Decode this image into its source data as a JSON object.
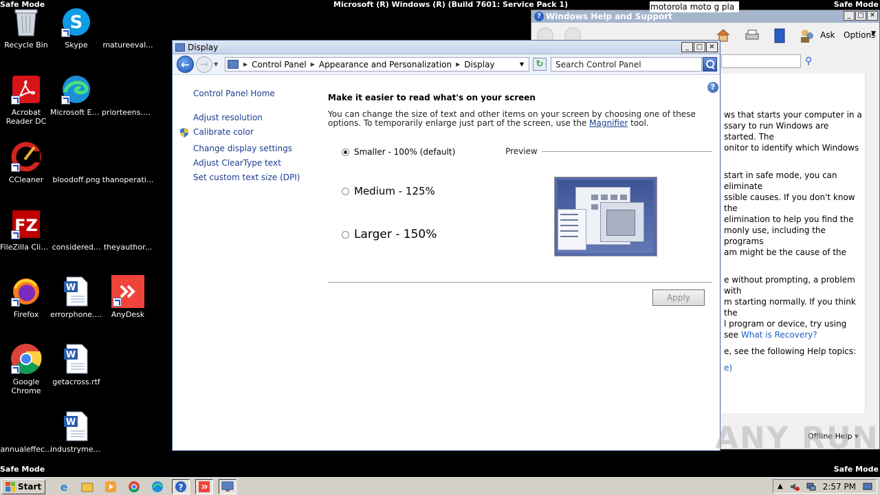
{
  "screen": {
    "top_left": "Safe Mode",
    "top_right": "Safe Mode",
    "bottom_left": "Safe Mode",
    "bottom_right": "Safe Mode",
    "build_title": "Microsoft (R) Windows (R) (Build 7601: Service Pack 1)",
    "floating_text": "motorola moto g pla"
  },
  "desktop_icons": [
    {
      "label": "Recycle Bin",
      "icon": "recycle-bin-icon"
    },
    {
      "label": "Skype",
      "icon": "skype-icon"
    },
    {
      "label": "matureeval...",
      "icon": "blank-file-icon"
    },
    {
      "label": "Acrobat Reader DC",
      "icon": "acrobat-icon"
    },
    {
      "label": "Microsoft Edge",
      "icon": "edge-icon"
    },
    {
      "label": "priorteens.png",
      "icon": "blank-file-icon"
    },
    {
      "label": "CCleaner",
      "icon": "ccleaner-icon"
    },
    {
      "label": "bloodoff.png",
      "icon": "blank-file-icon"
    },
    {
      "label": "thanoperati...",
      "icon": "blank-file-icon"
    },
    {
      "label": "FileZilla Client",
      "icon": "filezilla-icon"
    },
    {
      "label": "considered...",
      "icon": "blank-file-icon"
    },
    {
      "label": "theyauthor...",
      "icon": "blank-file-icon"
    },
    {
      "label": "Firefox",
      "icon": "firefox-icon"
    },
    {
      "label": "errorphone.rtf",
      "icon": "word-doc-icon"
    },
    {
      "label": "AnyDesk",
      "icon": "anydesk-icon"
    },
    {
      "label": "Google Chrome",
      "icon": "chrome-icon"
    },
    {
      "label": "getacross.rtf",
      "icon": "word-doc-icon"
    },
    {
      "label": "annualeffec...",
      "icon": "blank-file-icon"
    },
    {
      "label": "industrymee...",
      "icon": "word-doc-icon"
    }
  ],
  "help_window": {
    "title": "Windows Help and Support",
    "ask_label": "Ask",
    "options_label": "Options",
    "content": [
      "ws that starts your computer in a",
      "ssary to run Windows are started. The",
      "onitor to identify which Windows",
      "start in safe mode, you can eliminate",
      "ssible causes. If you don't know the",
      "elimination to help you find the",
      "monly use, including the programs",
      "am might be the cause of the",
      "e without prompting, a problem with",
      "m starting normally. If you think the",
      "l program or device, try using",
      "see",
      "e, see the following Help topics:",
      "e)"
    ],
    "recovery_link": "What is Recovery?",
    "offline_help": "Offline Help"
  },
  "display_window": {
    "title": "Display",
    "breadcrumbs": [
      "Control Panel",
      "Appearance and Personalization",
      "Display"
    ],
    "search_placeholder": "Search Control Panel",
    "left_nav": {
      "home": "Control Panel Home",
      "items": [
        "Adjust resolution",
        "Calibrate color",
        "Change display settings",
        "Adjust ClearType text",
        "Set custom text size (DPI)"
      ]
    },
    "heading": "Make it easier to read what's on your screen",
    "desc_part1": "You can change the size of text and other items on your screen by choosing one of these options. To temporarily enlarge just part of the screen, use the",
    "magnifier_link": "Magnifier",
    "desc_part2": "tool.",
    "options": [
      {
        "label": "Smaller - 100% (default)",
        "selected": true
      },
      {
        "label": "Medium - 125%",
        "selected": false
      },
      {
        "label": "Larger - 150%",
        "selected": false
      }
    ],
    "preview_label": "Preview",
    "apply_label": "Apply"
  },
  "taskbar": {
    "start_label": "Start",
    "clock": "2:57 PM"
  },
  "watermark": "ANY RUN"
}
